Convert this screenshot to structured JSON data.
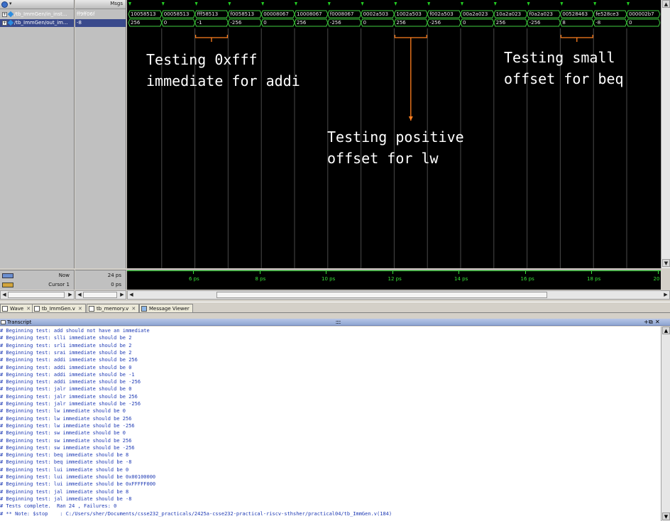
{
  "window": {
    "msgs_header": "Msgs"
  },
  "signals": [
    {
      "name": "/tb_ImmGen/in_inst...",
      "value": "ff9ff06f"
    },
    {
      "name": "/tb_ImmGen/out_im...",
      "value": "-8"
    }
  ],
  "wave": {
    "instructions": [
      "10058513",
      "00058513",
      "fff58513",
      "f0058513",
      "00008067",
      "10008067",
      "f0008067",
      "0002a503",
      "1002a503",
      "f002a503",
      "00a2a023",
      "10a2a023",
      "f0a2a023",
      "00528463",
      "fe528ce3",
      "000002b7"
    ],
    "immediates": [
      "256",
      "0",
      "-1",
      "-256",
      "0",
      "256",
      "-256",
      "0",
      "256",
      "-256",
      "0",
      "256",
      "-256",
      "8",
      "-8",
      "0"
    ],
    "annotations": [
      {
        "id": "addi",
        "text": "Testing 0xfff\nimmediate for addi"
      },
      {
        "id": "lw",
        "text": "Testing positive\noffset for lw"
      },
      {
        "id": "beq",
        "text": "Testing small\noffset for beq"
      }
    ],
    "colors": {
      "signal": "#3fd13f",
      "text": "#e8e8e8",
      "bracket": "#ff7f1f",
      "grid": "#4a4a4a",
      "marker": "#23d023"
    }
  },
  "status": {
    "now_label": "Now",
    "now_value": "24 ps",
    "cursor_label": "Cursor 1",
    "cursor_value": "0 ps"
  },
  "timeline": {
    "unit": "ps",
    "ticks": [
      "6 ps",
      "8 ps",
      "10 ps",
      "12 ps",
      "14 ps",
      "16 ps",
      "18 ps",
      "20"
    ]
  },
  "tabs": [
    {
      "label": "Wave",
      "icon": "wave-icon"
    },
    {
      "label": "tb_ImmGen.v",
      "icon": "file-icon"
    },
    {
      "label": "tb_memory.v",
      "icon": "file-icon"
    },
    {
      "label": "Message Viewer",
      "icon": "message-icon"
    }
  ],
  "transcript": {
    "title": "Transcript",
    "lines": [
      "Beginning test: add should not have an immediate",
      "Beginning test: slli immediate should be 2",
      "Beginning test: srli immediate should be 2",
      "Beginning test: srai immediate should be 2",
      "Beginning test: addi immediate should be 256",
      "Beginning test: addi immediate should be 0",
      "Beginning test: addi immediate should be -1",
      "Beginning test: addi immediate should be -256",
      "Beginning test: jalr immediate should be 0",
      "Beginning test: jalr immediate should be 256",
      "Beginning test: jalr immediate should be -256",
      "Beginning test: lw immediate should be 0",
      "Beginning test: lw immediate should be 256",
      "Beginning test: lw immediate should be -256",
      "Beginning test: sw immediate should be 0",
      "Beginning test: sw immediate should be 256",
      "Beginning test: sw immediate should be -256",
      "Beginning test: beq immediate should be 8",
      "Beginning test: beq immediate should be -8",
      "Beginning test: lui immediate should be 0",
      "Beginning test: lui immediate should be 0x00100000",
      "Beginning test: lui immediate should be 0xFFFFF000",
      "Beginning test: jal immediate should be 8",
      "Beginning test: jal immediate should be -8",
      "Tests complete.  Ran 24 , Failures: 0",
      "** Note: $stop    : C:/Users/sher/Documents/csse232_practicals/2425a-csse232-practical-riscv-sthsher/practical04/tb_ImmGen.v(184)"
    ]
  }
}
